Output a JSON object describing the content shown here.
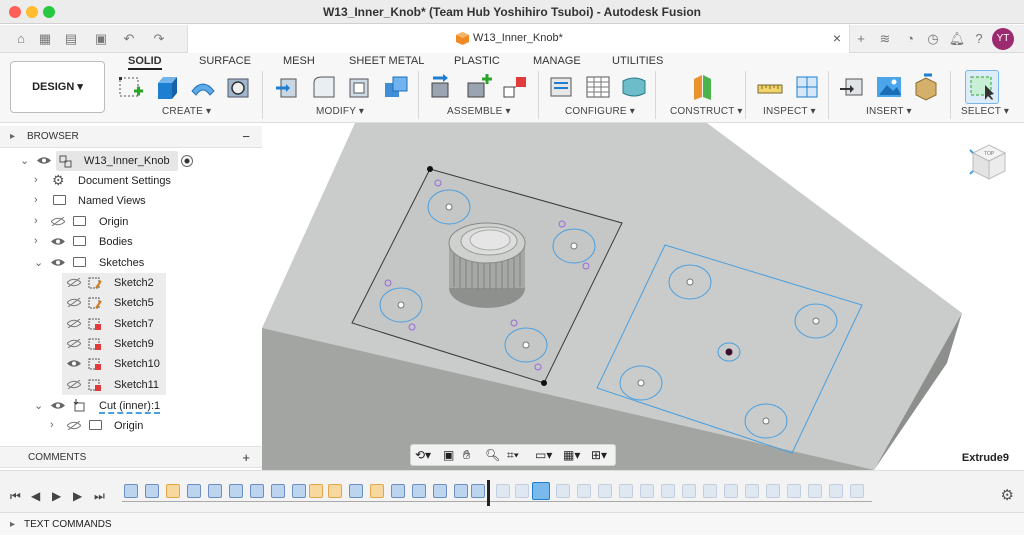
{
  "window": {
    "title": "W13_Inner_Knob* (Team Hub Yoshihiro Tsuboi) - Autodesk Fusion"
  },
  "tabbar": {
    "doc_tab_label": "W13_Inner_Knob*",
    "user_initials": "YT",
    "close": "×",
    "new_tab": "+"
  },
  "toolbar": {
    "design_label": "DESIGN ▾",
    "tabs": [
      "SOLID",
      "SURFACE",
      "MESH",
      "SHEET METAL",
      "PLASTIC",
      "MANAGE",
      "UTILITIES"
    ],
    "groups": [
      "CREATE ▾",
      "MODIFY ▾",
      "ASSEMBLE ▾",
      "CONFIGURE ▾",
      "CONSTRUCT ▾",
      "INSPECT ▾",
      "INSERT ▾",
      "SELECT ▾"
    ]
  },
  "browser": {
    "title": "BROWSER",
    "collapse": "−",
    "root": "W13_Inner_Knob",
    "items": [
      "Document Settings",
      "Named Views",
      "Origin",
      "Bodies",
      "Sketches",
      "Sketch2",
      "Sketch5",
      "Sketch7",
      "Sketch9",
      "Sketch10",
      "Sketch11",
      "Cut (inner):1",
      "Origin"
    ]
  },
  "comments": {
    "title": "COMMENTS",
    "add": "+"
  },
  "viewport": {
    "status": "Extrude9",
    "viewcube_label": "TOP"
  },
  "text_commands": "TEXT COMMANDS",
  "colors": {
    "accent": "#0696d7",
    "sketch_line": "#4a9fe0",
    "body": "#c9ccca",
    "body_side": "#a3a5a3"
  }
}
